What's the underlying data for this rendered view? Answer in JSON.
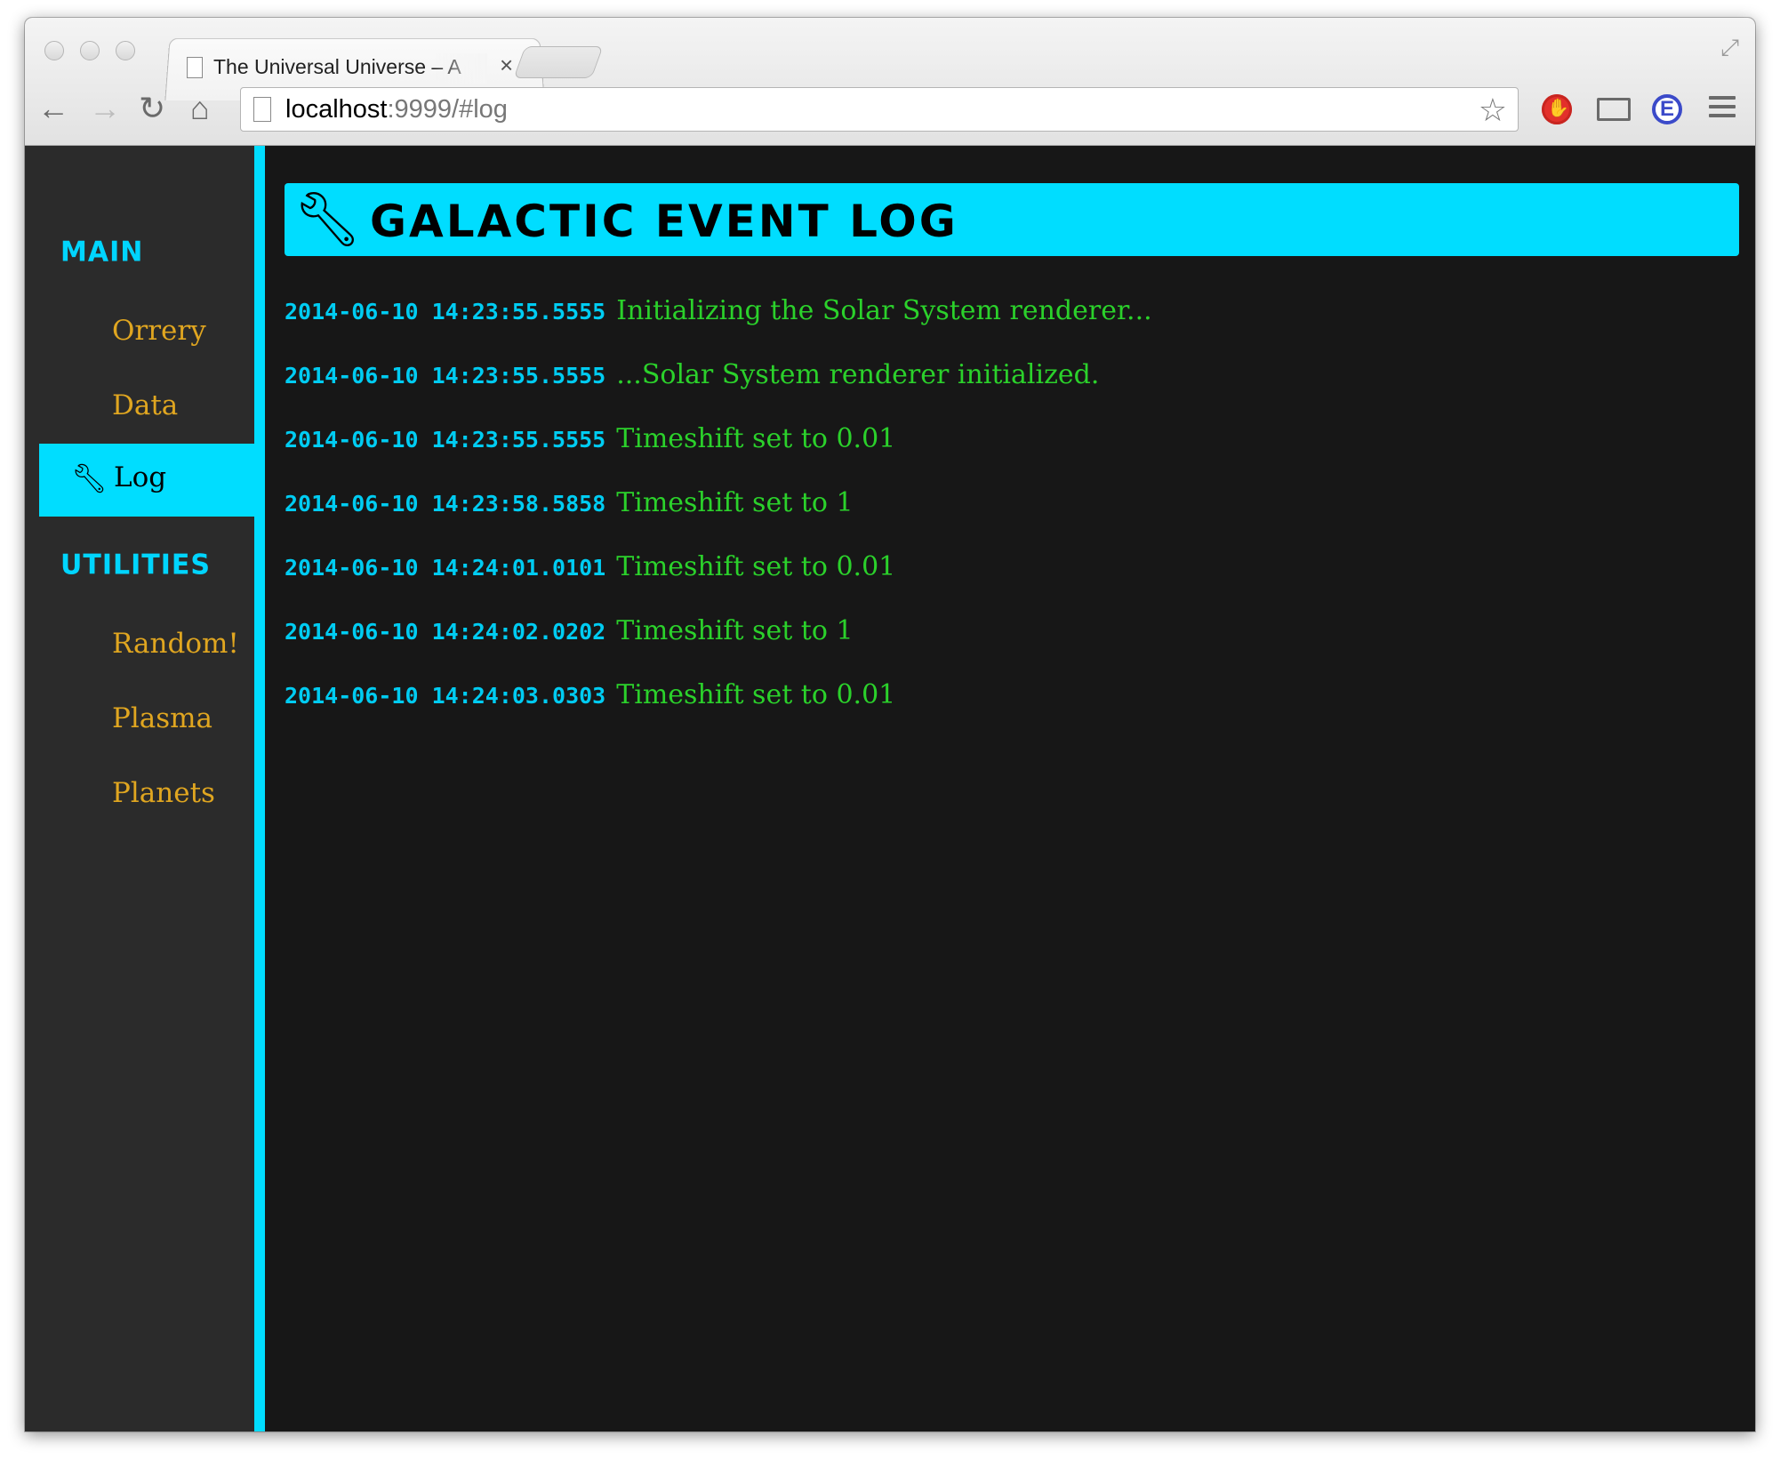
{
  "browser": {
    "tab_title": "The Universal Universe – A",
    "tab_close": "×",
    "url_host": "localhost",
    "url_rest": ":9999/#log"
  },
  "sidebar": {
    "sections": [
      {
        "heading": "MAIN",
        "items": [
          "Orrery",
          "Data",
          "Log"
        ]
      },
      {
        "heading": "UTILITIES",
        "items": [
          "Random!",
          "Plasma",
          "Planets"
        ]
      }
    ],
    "active_item": "Log"
  },
  "main": {
    "title": "GALACTIC EVENT LOG",
    "log": [
      {
        "time": "2014-06-10 14:23:55.5555",
        "message": "Initializing the Solar System renderer..."
      },
      {
        "time": "2014-06-10 14:23:55.5555",
        "message": "...Solar System renderer initialized."
      },
      {
        "time": "2014-06-10 14:23:55.5555",
        "message": "Timeshift set to 0.01"
      },
      {
        "time": "2014-06-10 14:23:58.5858",
        "message": "Timeshift set to 1"
      },
      {
        "time": "2014-06-10 14:24:01.0101",
        "message": "Timeshift set to 0.01"
      },
      {
        "time": "2014-06-10 14:24:02.0202",
        "message": "Timeshift set to 1"
      },
      {
        "time": "2014-06-10 14:24:03.0303",
        "message": "Timeshift set to 0.01"
      }
    ]
  },
  "colors": {
    "accent": "#00ddff",
    "nav_text": "#e0a620",
    "log_message": "#2bd12b",
    "log_time": "#00ccf2",
    "sidebar_bg": "#2b2b2b",
    "main_bg": "#171717"
  }
}
